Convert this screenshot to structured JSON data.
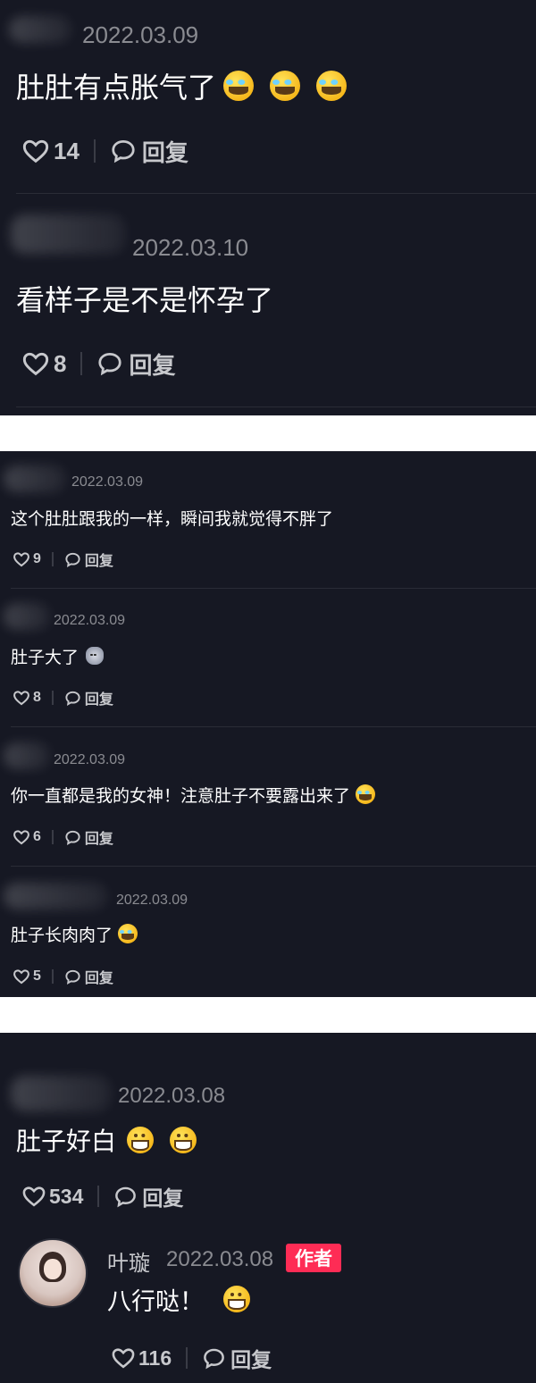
{
  "panel1": {
    "comments": [
      {
        "date": "2022.03.09",
        "text": "肚肚有点胀气了",
        "likes": "14",
        "reply_label": "回复"
      },
      {
        "date": "2022.03.10",
        "text": "看样子是不是怀孕了",
        "likes": "8",
        "reply_label": "回复"
      }
    ]
  },
  "panel2": {
    "comments": [
      {
        "date": "2022.03.09",
        "text": "这个肚肚跟我的一样，瞬间我就觉得不胖了",
        "likes": "9",
        "reply_label": "回复"
      },
      {
        "date": "2022.03.09",
        "text": "肚子大了",
        "likes": "8",
        "reply_label": "回复"
      },
      {
        "date": "2022.03.09",
        "text": "你一直都是我的女神！注意肚子不要露出来了",
        "likes": "6",
        "reply_label": "回复"
      },
      {
        "date": "2022.03.09",
        "text": "肚子长肉肉了",
        "likes": "5",
        "reply_label": "回复"
      }
    ]
  },
  "panel3": {
    "comment": {
      "date": "2022.03.08",
      "text": "肚子好白",
      "likes": "534",
      "reply_label": "回复"
    },
    "reply": {
      "name": "叶璇",
      "date": "2022.03.08",
      "badge": "作者",
      "text": "八行哒！",
      "likes": "116",
      "reply_label": "回复"
    }
  },
  "icons": {
    "like": "heart-outline-icon",
    "reply": "speech-bubble-icon",
    "laugh": "laughing-tears-emoji",
    "grin": "grinning-emoji",
    "cat": "cat-face-emoji"
  },
  "colors": {
    "background": "#161823",
    "text": "#ffffff",
    "muted": "#8a8b91",
    "author_badge": "#fe2c55"
  }
}
